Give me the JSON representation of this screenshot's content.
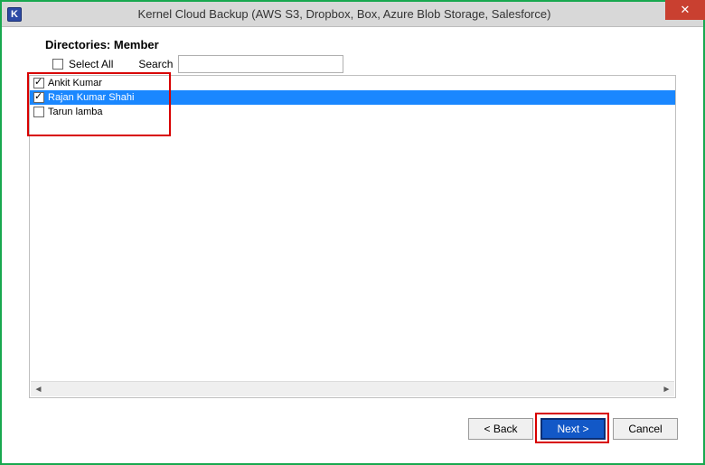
{
  "window": {
    "title": "Kernel Cloud Backup (AWS S3, Dropbox, Box, Azure Blob Storage, Salesforce)",
    "app_icon_letter": "K"
  },
  "section": {
    "heading": "Directories: Member",
    "select_all_label": "Select All",
    "search_label": "Search",
    "search_value": ""
  },
  "members": [
    {
      "name": "Ankit Kumar",
      "checked": true,
      "selected": false
    },
    {
      "name": "Rajan Kumar Shahi",
      "checked": true,
      "selected": true
    },
    {
      "name": "Tarun lamba",
      "checked": false,
      "selected": false
    }
  ],
  "buttons": {
    "back": "< Back",
    "next": "Next >",
    "cancel": "Cancel"
  },
  "colors": {
    "accent_green": "#18a84f",
    "selection_blue": "#1a87ff",
    "primary_button": "#1258c7",
    "annotation_red": "#d80000",
    "close_red": "#c94030"
  }
}
